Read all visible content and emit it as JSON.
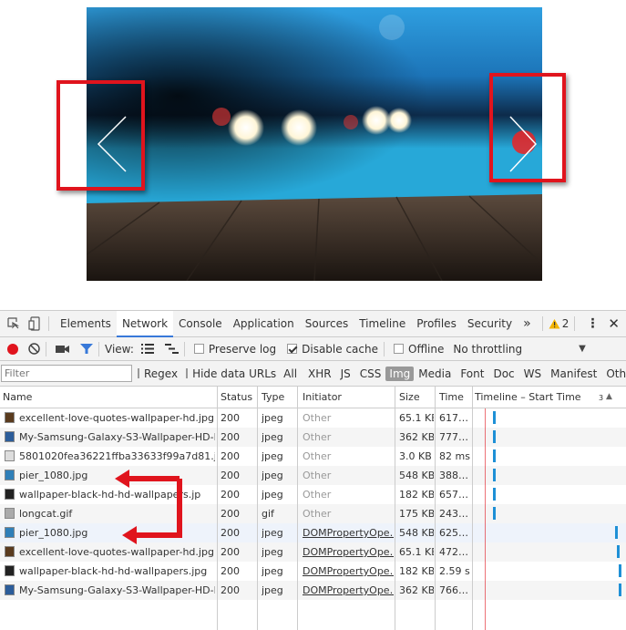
{
  "slider": {
    "prev": "chevron-left-icon",
    "next": "chevron-right-icon"
  },
  "tabs": [
    "Elements",
    "Network",
    "Console",
    "Application",
    "Sources",
    "Timeline",
    "Profiles",
    "Security"
  ],
  "tabs_more": "»",
  "warning_count": "2",
  "toolbar": {
    "view_label": "View:",
    "preserve_log": "Preserve log",
    "disable_cache": "Disable cache",
    "offline": "Offline",
    "throttling": "No throttling"
  },
  "filter": {
    "placeholder": "Filter",
    "regex": "Regex",
    "hide_data_urls": "Hide data URLs",
    "types": [
      "All",
      "XHR",
      "JS",
      "CSS",
      "Img",
      "Media",
      "Font",
      "Doc",
      "WS",
      "Manifest",
      "Other"
    ],
    "selected": "Img"
  },
  "columns": {
    "name": "Name",
    "status": "Status",
    "type": "Type",
    "initiator": "Initiator",
    "size": "Size",
    "time": "Time",
    "timeline": "Timeline – Start Time",
    "timeline_num": "3"
  },
  "rows": [
    {
      "name": "excellent-love-quotes-wallpaper-hd.jpg",
      "status": "200",
      "type": "jpeg",
      "initiator": "Other",
      "size": "65.1 KB",
      "time": "617…"
    },
    {
      "name": "My-Samsung-Galaxy-S3-Wallpaper-HD-L…",
      "status": "200",
      "type": "jpeg",
      "initiator": "Other",
      "size": "362 KB",
      "time": "777…"
    },
    {
      "name": "5801020fea36221ffba33633f99a7d81.jpg",
      "status": "200",
      "type": "jpeg",
      "initiator": "Other",
      "size": "3.0 KB",
      "time": "82 ms"
    },
    {
      "name": "pier_1080.jpg",
      "status": "200",
      "type": "jpeg",
      "initiator": "Other",
      "size": "548 KB",
      "time": "388…"
    },
    {
      "name": "wallpaper-black-hd-hd-wallpapers.jp",
      "status": "200",
      "type": "jpeg",
      "initiator": "Other",
      "size": "182 KB",
      "time": "657…"
    },
    {
      "name": "longcat.gif",
      "status": "200",
      "type": "gif",
      "initiator": "Other",
      "size": "175 KB",
      "time": "243…"
    },
    {
      "name": "pier_1080.jpg",
      "status": "200",
      "type": "jpeg",
      "initiator": "DOMPropertyOpe…",
      "size": "548 KB",
      "time": "625…"
    },
    {
      "name": "excellent-love-quotes-wallpaper-hd.jpg",
      "status": "200",
      "type": "jpeg",
      "initiator": "DOMPropertyOpe…",
      "size": "65.1 KB",
      "time": "472…"
    },
    {
      "name": "wallpaper-black-hd-hd-wallpapers.jpg",
      "status": "200",
      "type": "jpeg",
      "initiator": "DOMPropertyOpe…",
      "size": "182 KB",
      "time": "2.59 s"
    },
    {
      "name": "My-Samsung-Galaxy-S3-Wallpaper-HD-L…",
      "status": "200",
      "type": "jpeg",
      "initiator": "DOMPropertyOpe…",
      "size": "362 KB",
      "time": "766…"
    }
  ],
  "colors": {
    "highlight": "#e0141d",
    "accent": "#3879d9",
    "waterfall": "#1e90d6"
  }
}
